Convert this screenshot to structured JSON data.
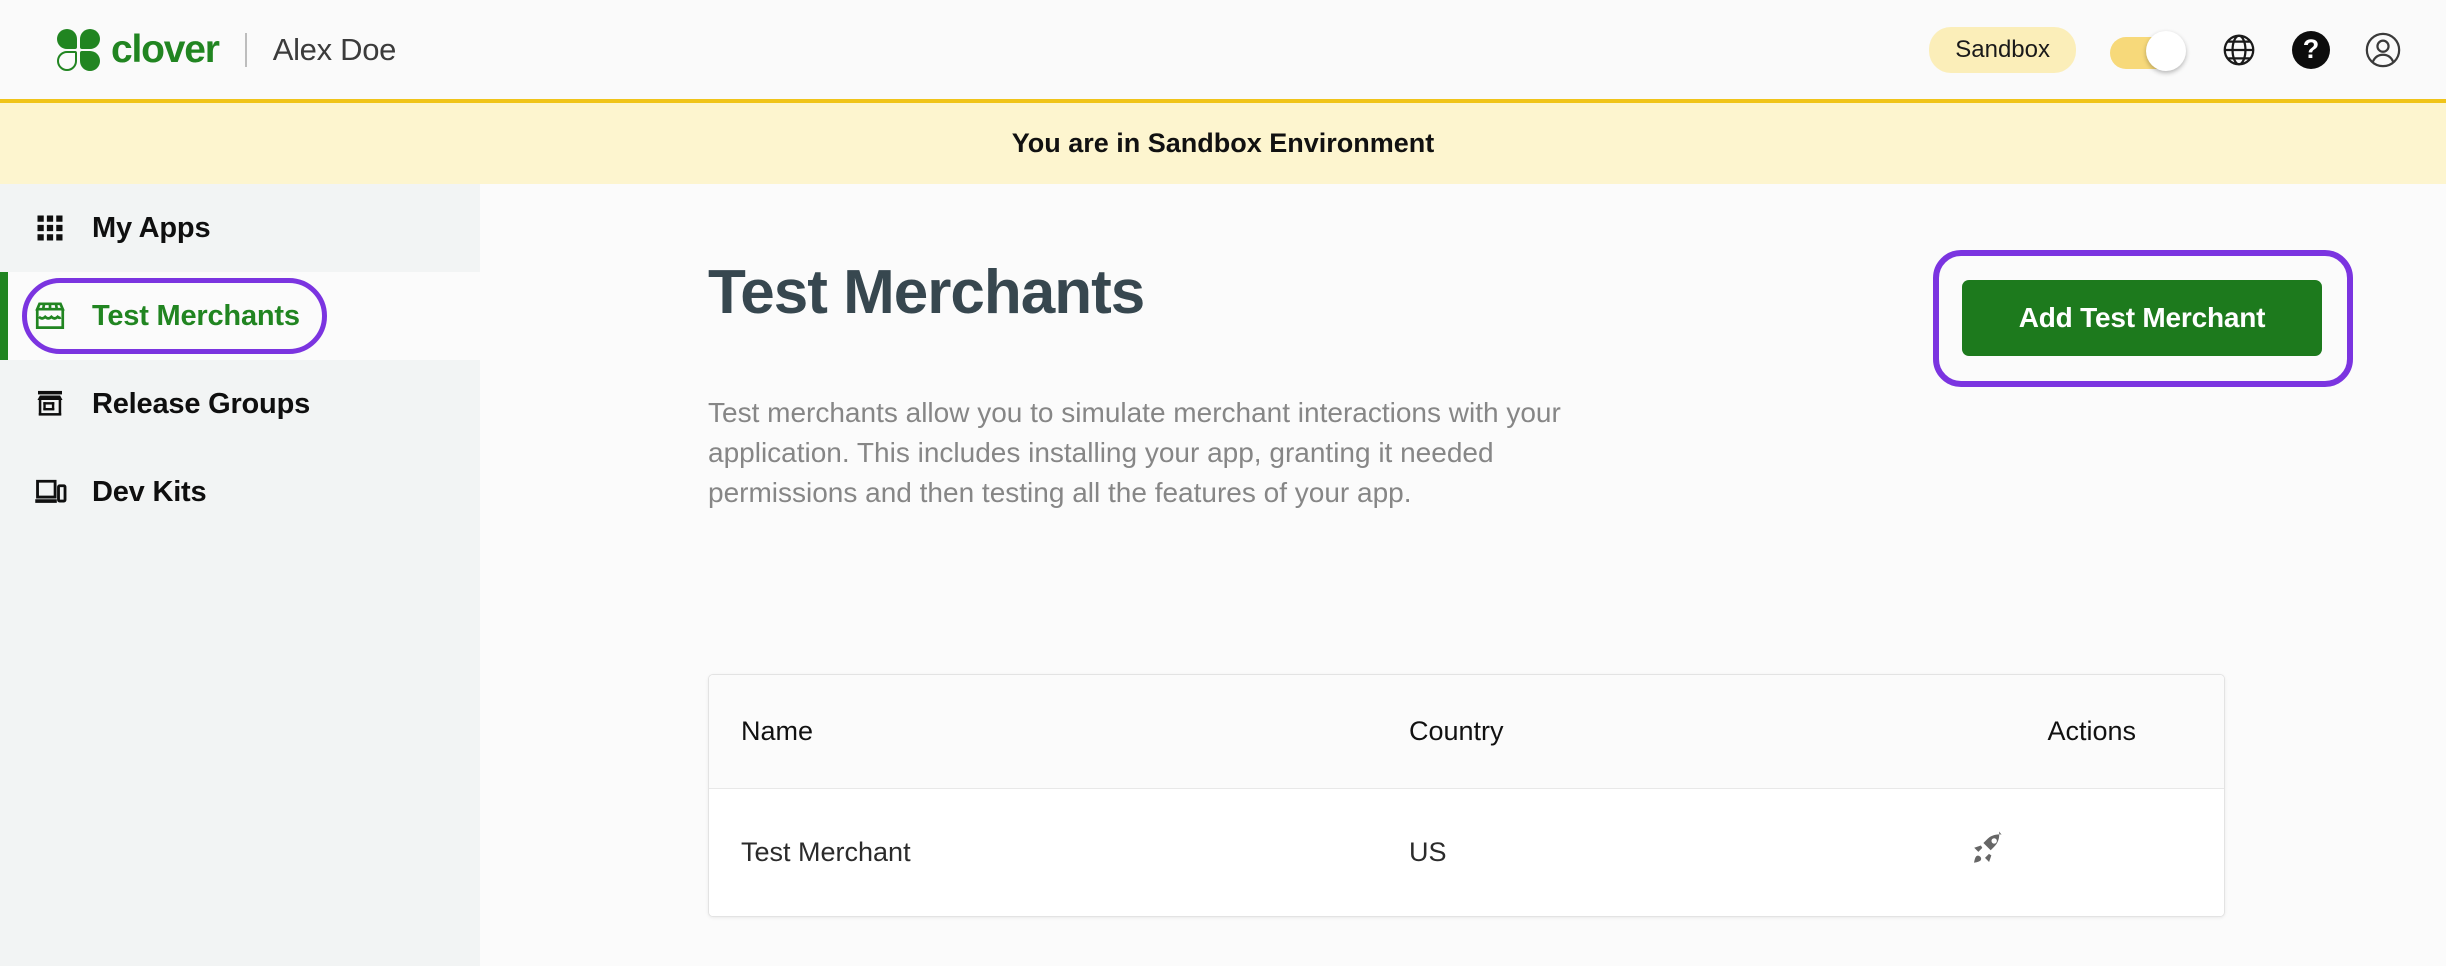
{
  "header": {
    "brand_name": "clover",
    "brand_logo_icon": "clover-logo-icon",
    "user_name": "Alex Doe",
    "sandbox_pill_label": "Sandbox",
    "toggle_state": "on",
    "globe_icon": "globe-icon",
    "help_icon": "help-question-icon",
    "help_glyph": "?",
    "account_icon": "account-avatar-icon",
    "brand_color": "#218521",
    "background": "#fafafa"
  },
  "banner": {
    "text": "You are in Sandbox Environment",
    "background": "#fdf5cf",
    "border_color": "#f0c419",
    "text_color": "#111111"
  },
  "sidebar": {
    "background": "#f2f4f4",
    "active_accent_color": "#218521",
    "items": [
      {
        "label": "My Apps",
        "icon": "grid-apps-icon",
        "active": false
      },
      {
        "label": "Test Merchants",
        "icon": "storefront-icon",
        "active": true
      },
      {
        "label": "Release Groups",
        "icon": "shop-icon",
        "active": false
      },
      {
        "label": "Dev Kits",
        "icon": "devices-icon",
        "active": false
      }
    ]
  },
  "main": {
    "title": "Test Merchants",
    "description": "Test merchants allow you to simulate merchant interactions with your application. This includes installing your app, granting it needed permissions and then testing all the features of your app.",
    "add_button_label": "Add Test Merchant",
    "add_button_color": "#1d7a1d",
    "title_color": "#37474f",
    "description_color": "#868686"
  },
  "table": {
    "columns": [
      "Name",
      "Country",
      "Actions"
    ],
    "rows": [
      {
        "name": "Test Merchant",
        "country": "US",
        "action_icon": "rocket-icon"
      }
    ]
  },
  "annotations": {
    "color": "#7b34e0",
    "targets": [
      "sidebar-item-test-merchants",
      "add-test-merchant-button"
    ]
  }
}
